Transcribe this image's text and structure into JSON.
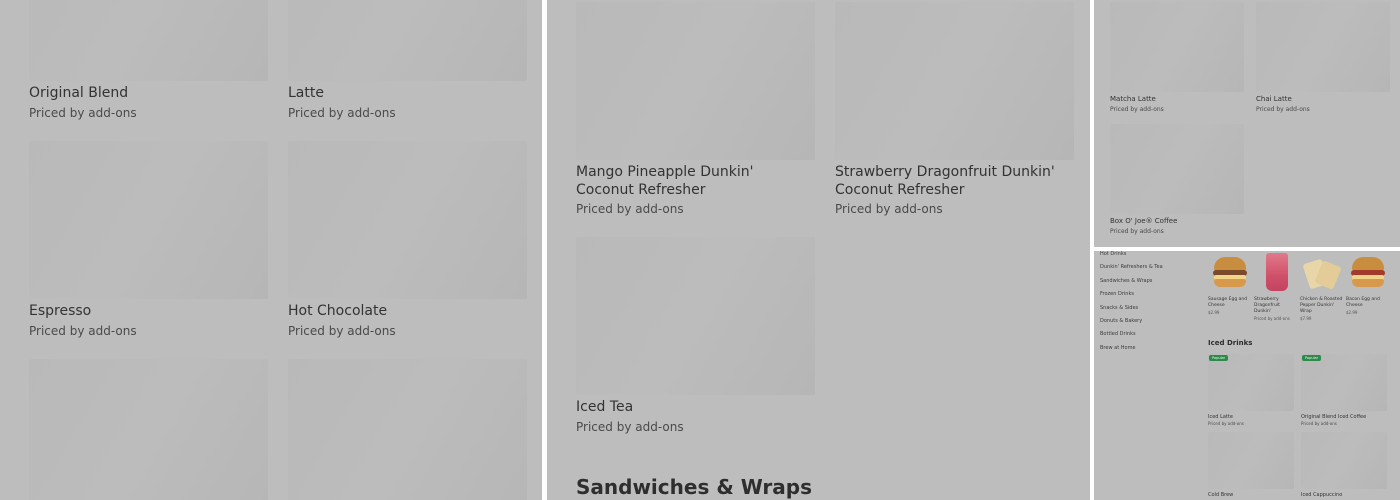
{
  "panel1": {
    "items": [
      {
        "name": "Original Blend",
        "price": "Priced by add-ons"
      },
      {
        "name": "Latte",
        "price": "Priced by add-ons"
      },
      {
        "name": "Espresso",
        "price": "Priced by add-ons"
      },
      {
        "name": "Hot Chocolate",
        "price": "Priced by add-ons"
      }
    ]
  },
  "panel2": {
    "items": [
      {
        "name": "Mango Pineapple Dunkin' Coconut Refresher",
        "price": "Priced by add-ons"
      },
      {
        "name": "Strawberry Dragonfruit Dunkin' Coconut Refresher",
        "price": "Priced by add-ons"
      },
      {
        "name": "Iced Tea",
        "price": "Priced by add-ons"
      }
    ],
    "section_heading": "Sandwiches & Wraps"
  },
  "panel3": {
    "items": [
      {
        "name": "Matcha Latte",
        "price": "Priced by add-ons"
      },
      {
        "name": "Chai Latte",
        "price": "Priced by add-ons"
      },
      {
        "name": "Box O' Joe® Coffee",
        "price": "Priced by add-ons"
      }
    ]
  },
  "panel4": {
    "nav": [
      "Hot Drinks",
      "Dunkin' Refreshers & Tea",
      "Sandwiches & Wraps",
      "Frozen Drinks",
      "Snacks & Sides",
      "Donuts & Bakery",
      "Bottled Drinks",
      "Brew at Home"
    ],
    "featured": [
      {
        "name": "Sausage Egg and Cheese",
        "price": "$2.99"
      },
      {
        "name": "Strawberry Dragonfruit Dunkin'",
        "price": "Priced by add-ons"
      },
      {
        "name": "Chicken & Roasted Pepper Dunkin' Wrap",
        "price": "$7.99"
      },
      {
        "name": "Bacon Egg and Cheese",
        "price": "$2.99"
      }
    ],
    "heading": "Iced Drinks",
    "badge": "Popular",
    "items": [
      {
        "name": "Iced Latte",
        "price": "Priced by add-ons"
      },
      {
        "name": "Original Blend Iced Coffee",
        "price": "Priced by add-ons"
      },
      {
        "name": "Cold Brew",
        "price": ""
      },
      {
        "name": "Iced Cappuccino",
        "price": ""
      }
    ]
  }
}
